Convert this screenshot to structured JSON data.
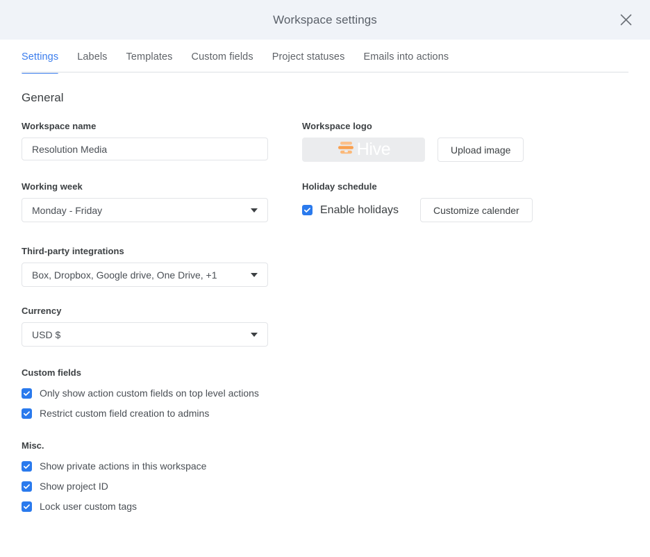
{
  "header": {
    "title": "Workspace settings",
    "close_icon": "close-icon"
  },
  "tabs": [
    {
      "label": "Settings",
      "active": true
    },
    {
      "label": "Labels",
      "active": false
    },
    {
      "label": "Templates",
      "active": false
    },
    {
      "label": "Custom fields",
      "active": false
    },
    {
      "label": "Project statuses",
      "active": false
    },
    {
      "label": "Emails into actions",
      "active": false
    }
  ],
  "general": {
    "section_title": "General",
    "workspace_name": {
      "label": "Workspace name",
      "value": "Resolution Media"
    },
    "workspace_logo": {
      "label": "Workspace logo",
      "logo_text": "Hive",
      "upload_button": "Upload image"
    },
    "working_week": {
      "label": "Working week",
      "value": "Monday - Friday"
    },
    "holiday_schedule": {
      "label": "Holiday schedule",
      "checkbox_label": "Enable holidays",
      "checked": true,
      "button": "Customize calender"
    },
    "third_party": {
      "label": "Third-party integrations",
      "value": "Box, Dropbox, Google drive, One Drive,  +1"
    },
    "currency": {
      "label": "Currency",
      "value": "USD $"
    }
  },
  "custom_fields": {
    "title": "Custom fields",
    "options": [
      {
        "label": "Only show action custom fields on top level actions",
        "checked": true
      },
      {
        "label": "Restrict custom field creation to admins",
        "checked": true
      }
    ]
  },
  "misc": {
    "title": "Misc.",
    "options": [
      {
        "label": "Show private actions in this workspace",
        "checked": true
      },
      {
        "label": "Show project ID",
        "checked": true
      },
      {
        "label": "Lock user custom tags",
        "checked": true
      }
    ]
  },
  "colors": {
    "accent_blue": "#3b7ded",
    "checkbox_blue": "#2a7aed",
    "header_bg": "#f0f3f8",
    "logo_orange": "#f9a04f",
    "logo_bg": "#ebecee"
  }
}
